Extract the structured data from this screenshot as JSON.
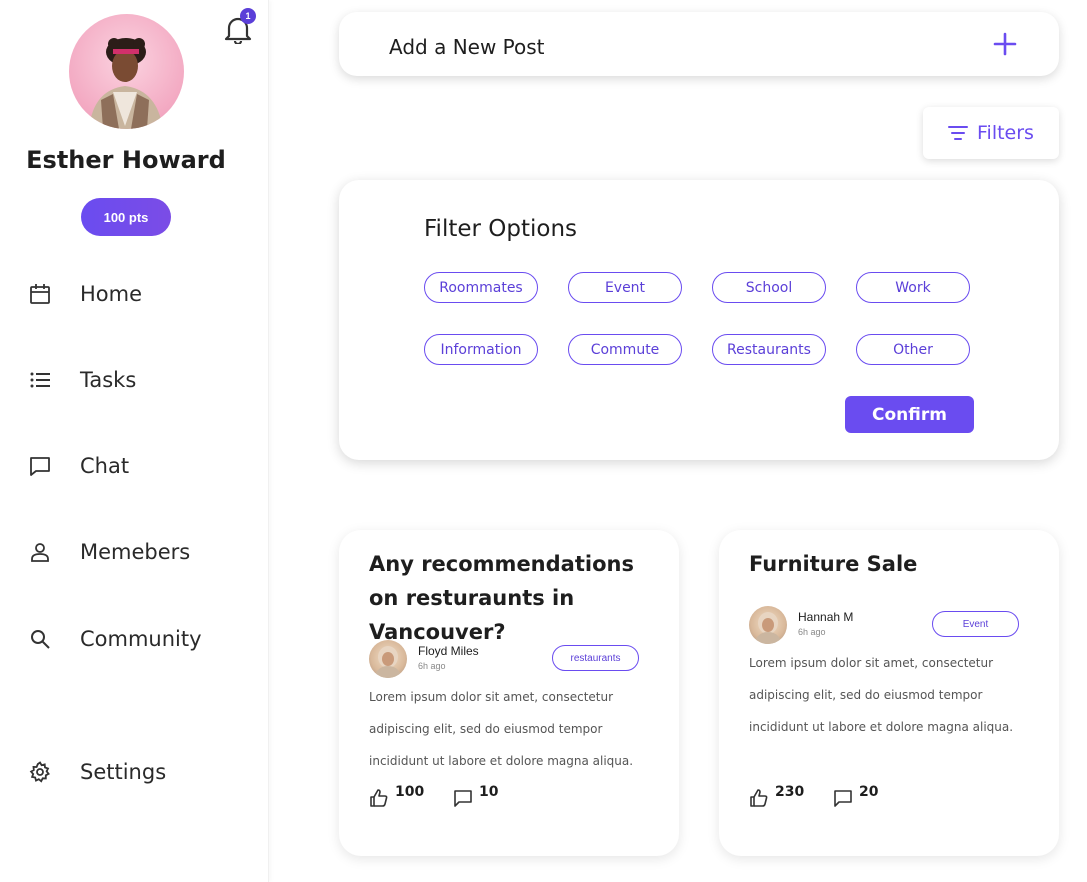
{
  "profile": {
    "name": "Esther Howard",
    "points": "100 pts",
    "notification_count": "1"
  },
  "nav": {
    "items": [
      {
        "label": "Home",
        "icon": "calendar-icon"
      },
      {
        "label": "Tasks",
        "icon": "list-icon"
      },
      {
        "label": "Chat",
        "icon": "chat-icon"
      },
      {
        "label": "Memebers",
        "icon": "person-icon"
      },
      {
        "label": "Community",
        "icon": "search-icon"
      }
    ],
    "settings": {
      "label": "Settings",
      "icon": "gear-icon"
    }
  },
  "add_post": {
    "label": "Add a New Post"
  },
  "filters": {
    "button_label": "Filters",
    "panel_title": "Filter Options",
    "options": [
      "Roommates",
      "Event",
      "School",
      "Work",
      "Information",
      "Commute",
      "Restaurants",
      "Other"
    ],
    "confirm_label": "Confirm"
  },
  "posts": [
    {
      "title": "Any recommendations on resturaunts in Vancouver?",
      "author": "Floyd Miles",
      "time": "6h ago",
      "tag": "restaurants",
      "body": "Lorem ipsum dolor sit amet, consectetur adipiscing elit, sed do eiusmod tempor incididunt ut labore et dolore magna aliqua.",
      "likes": "100",
      "comments": "10"
    },
    {
      "title": "Furniture Sale",
      "author": "Hannah M",
      "time": "6h ago",
      "tag": "Event",
      "body": "Lorem ipsum dolor sit amet, consectetur adipiscing elit, sed do eiusmod tempor incididunt ut labore et dolore magna aliqua.",
      "likes": "230",
      "comments": "20"
    }
  ],
  "colors": {
    "accent": "#6a4cf0",
    "badge": "#5b3fd8",
    "text": "#1e1e1e"
  }
}
